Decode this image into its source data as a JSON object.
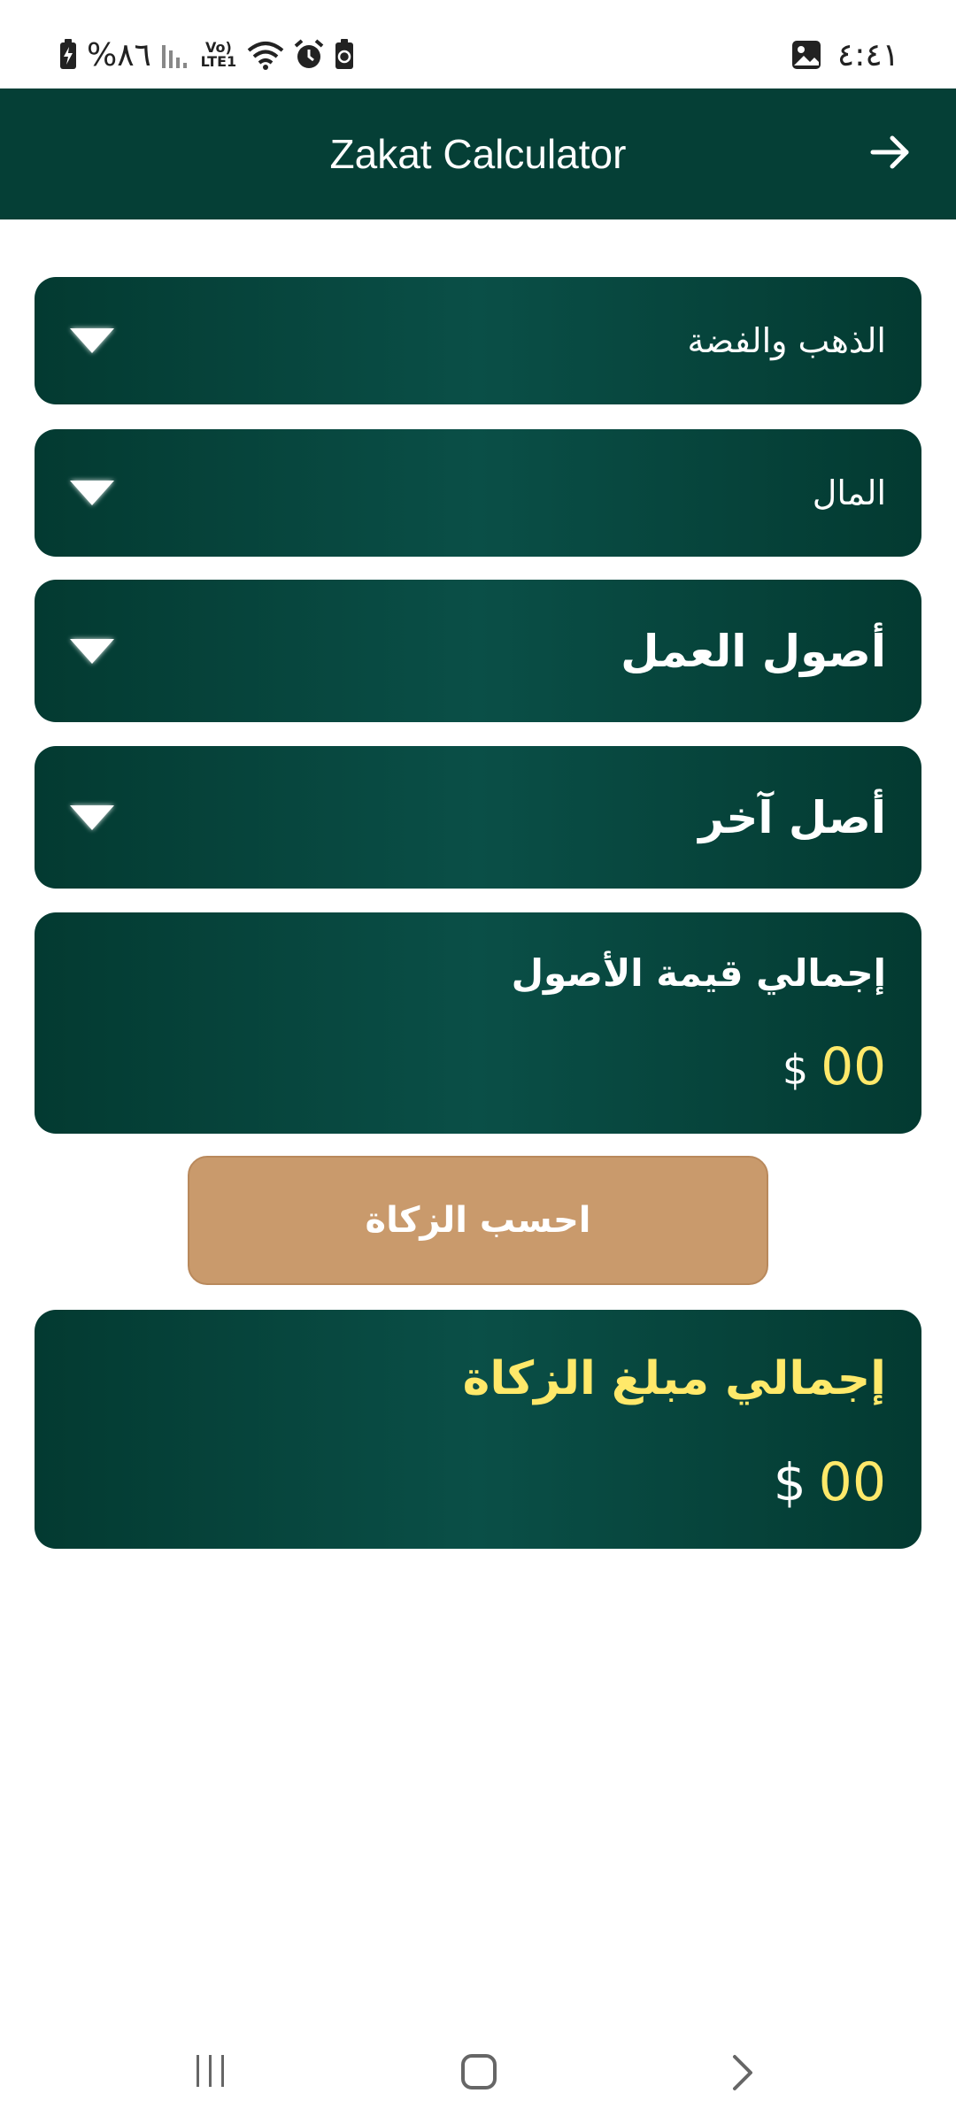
{
  "status_bar": {
    "battery": "%٨٦",
    "network": "Vo) LTE1",
    "time": "٤:٤١"
  },
  "app_bar": {
    "title": "Zakat Calculator",
    "back_icon": "arrow-right-icon"
  },
  "categories": [
    {
      "label": "الذهب والفضة"
    },
    {
      "label": "المال"
    },
    {
      "label": "أصول العمل"
    },
    {
      "label": "أصل آخر"
    }
  ],
  "assets_total": {
    "label": "إجمالي قيمة الأصول",
    "currency": "$",
    "value": "00"
  },
  "calculate_button": {
    "label": "احسب الزكاة"
  },
  "zakat_total": {
    "label": "إجمالي مبلغ الزكاة",
    "currency": "$",
    "value": "00"
  },
  "colors": {
    "primary": "#053f36",
    "accent_button": "#c99a6c",
    "value_yellow": "#ffe96a"
  }
}
